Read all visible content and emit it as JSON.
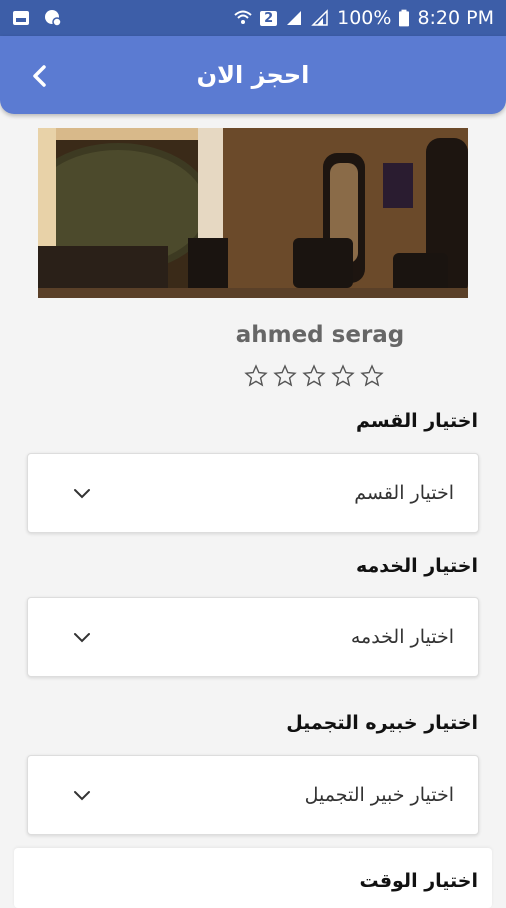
{
  "status_bar": {
    "battery": "100%",
    "time": "8:20 PM",
    "sim_label": "2"
  },
  "header": {
    "title": "احجز الان",
    "back_icon": "chevron-left-icon"
  },
  "profile": {
    "name": "ahmed serag",
    "rating_stars": 5,
    "rating_value": 0
  },
  "form": {
    "department_label": "اختيار القسم",
    "department_value": "اختيار القسم",
    "service_label": "اختيار الخدمه",
    "service_value": "اختيار الخدمه",
    "stylist_label": "اختيار خبيره التجميل",
    "stylist_value": "اختيار خبير التجميل",
    "time_label": "اختيار الوقت"
  },
  "colors": {
    "status_bar": "#3d5ea8",
    "app_bar": "#5b7bd2"
  }
}
